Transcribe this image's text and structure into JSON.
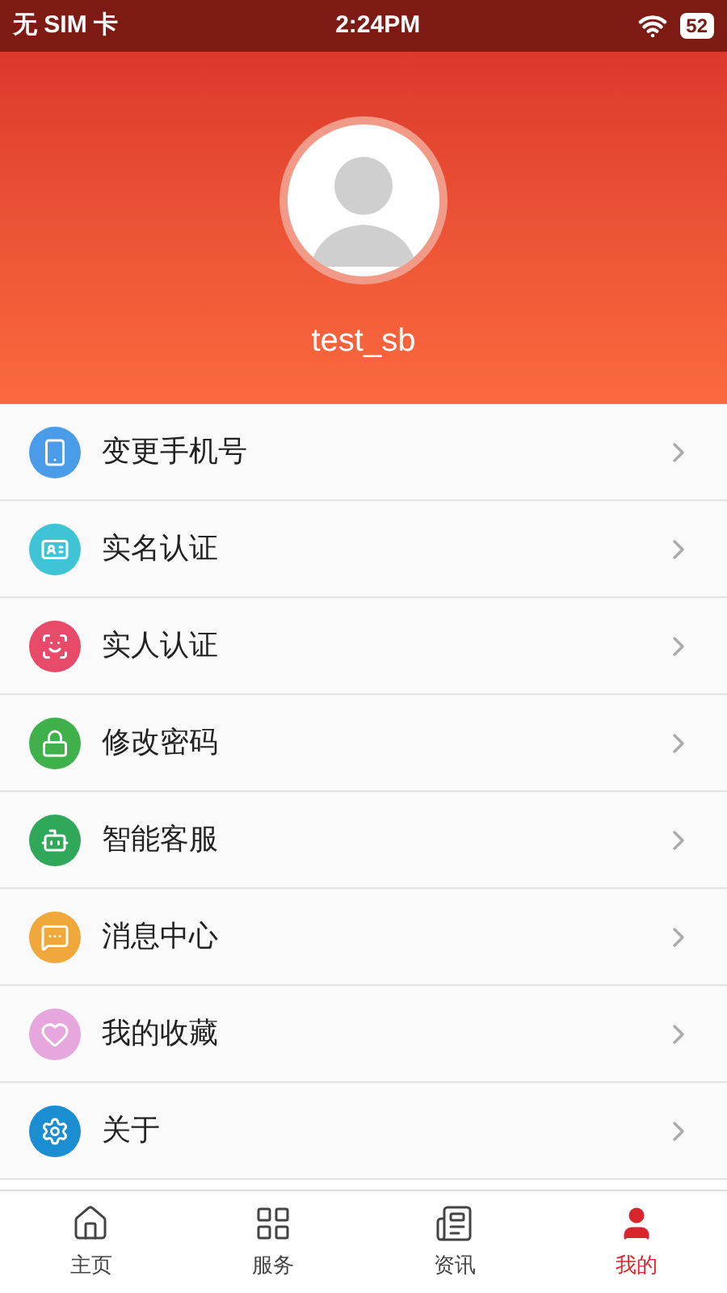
{
  "status_bar": {
    "carrier": "无 SIM 卡",
    "time": "2:24PM",
    "battery": "52"
  },
  "profile": {
    "username": "test_sb"
  },
  "menu": [
    {
      "label": "变更手机号",
      "kind": "phone",
      "color": "#4a9be8"
    },
    {
      "label": "实名认证",
      "kind": "idcard",
      "color": "#3fc4d6"
    },
    {
      "label": "实人认证",
      "kind": "face",
      "color": "#e84a6a"
    },
    {
      "label": "修改密码",
      "kind": "lock",
      "color": "#3fb04a"
    },
    {
      "label": "智能客服",
      "kind": "robot",
      "color": "#2fa85a"
    },
    {
      "label": "消息中心",
      "kind": "message",
      "color": "#f0a83a"
    },
    {
      "label": "我的收藏",
      "kind": "heart",
      "color": "#e6a8dc"
    },
    {
      "label": "关于",
      "kind": "gear",
      "color": "#1a8ed0"
    }
  ],
  "tabs": [
    {
      "label": "主页",
      "kind": "home",
      "selected": false
    },
    {
      "label": "服务",
      "kind": "service",
      "selected": false
    },
    {
      "label": "资讯",
      "kind": "news",
      "selected": false
    },
    {
      "label": "我的",
      "kind": "me",
      "selected": true
    }
  ]
}
